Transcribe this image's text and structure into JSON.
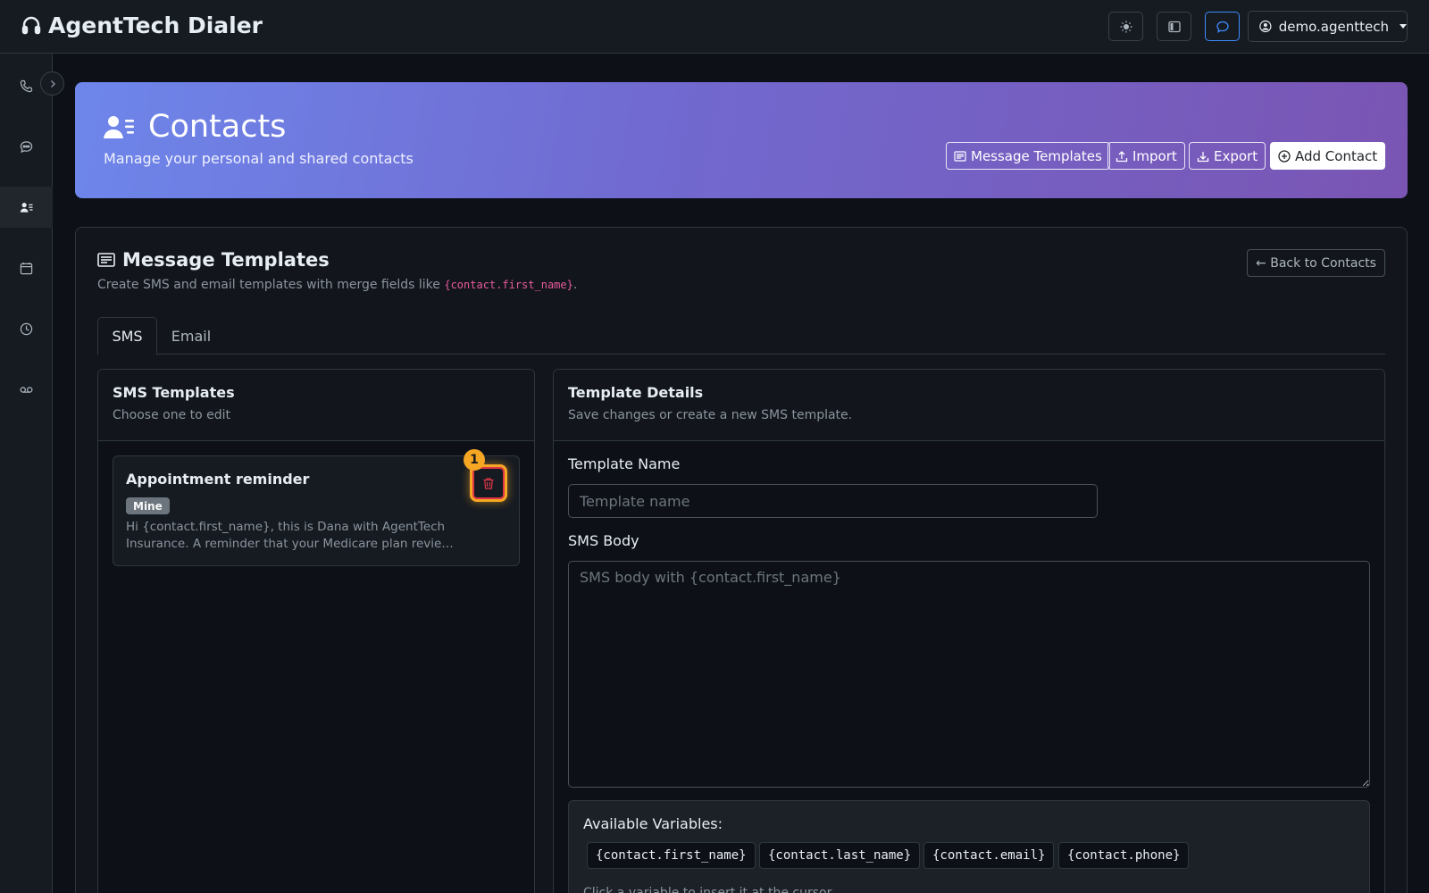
{
  "app": {
    "brand": "AgentTech Dialer",
    "user": "demo.agenttech",
    "header_icons": [
      "sun-icon",
      "sidebar-toggle-icon",
      "chat-icon"
    ]
  },
  "sidebar": {
    "items": [
      {
        "icon": "phone-icon",
        "active": false
      },
      {
        "icon": "message-icon",
        "active": false
      },
      {
        "icon": "contacts-icon",
        "active": true
      },
      {
        "icon": "calendar-icon",
        "active": false
      },
      {
        "icon": "history-icon",
        "active": false
      },
      {
        "icon": "voicemail-icon",
        "active": false
      }
    ]
  },
  "hero": {
    "title": "Contacts",
    "subtitle": "Manage your personal and shared contacts",
    "buttons": {
      "templates": "Message Templates",
      "import": "Import",
      "export": "Export",
      "add": "Add Contact"
    }
  },
  "templates": {
    "title": "Message Templates",
    "desc_prefix": "Create SMS and email templates with merge fields like",
    "desc_code": "{contact.first_name}",
    "desc_suffix": ".",
    "back": "← Back to Contacts",
    "tabs": [
      {
        "label": "SMS",
        "active": true
      },
      {
        "label": "Email",
        "active": false
      }
    ],
    "list": {
      "title": "SMS Templates",
      "subtitle": "Choose one to edit",
      "items": [
        {
          "name": "Appointment reminder",
          "badge": "Mine",
          "preview": "Hi {contact.first_name}, this is Dana with AgentTech Insurance. A reminder that your Medicare plan revie…",
          "step": "1"
        }
      ]
    },
    "details": {
      "title": "Template Details",
      "subtitle": "Save changes or create a new SMS template.",
      "name_label": "Template Name",
      "name_placeholder": "Template name",
      "name_value": "",
      "body_label": "SMS Body",
      "body_placeholder": "SMS body with {contact.first_name}",
      "body_value": "",
      "vars_title": "Available Variables:",
      "vars": [
        "{contact.first_name}",
        "{contact.last_name}",
        "{contact.email}",
        "{contact.phone}"
      ],
      "vars_hint": "Click a variable to insert it at the cursor"
    }
  },
  "colors": {
    "accent": "#3d8bfd",
    "danger": "#dc3545",
    "highlight": "#f5a623",
    "hero_start": "#6e86ea",
    "hero_end": "#7a55b3"
  }
}
